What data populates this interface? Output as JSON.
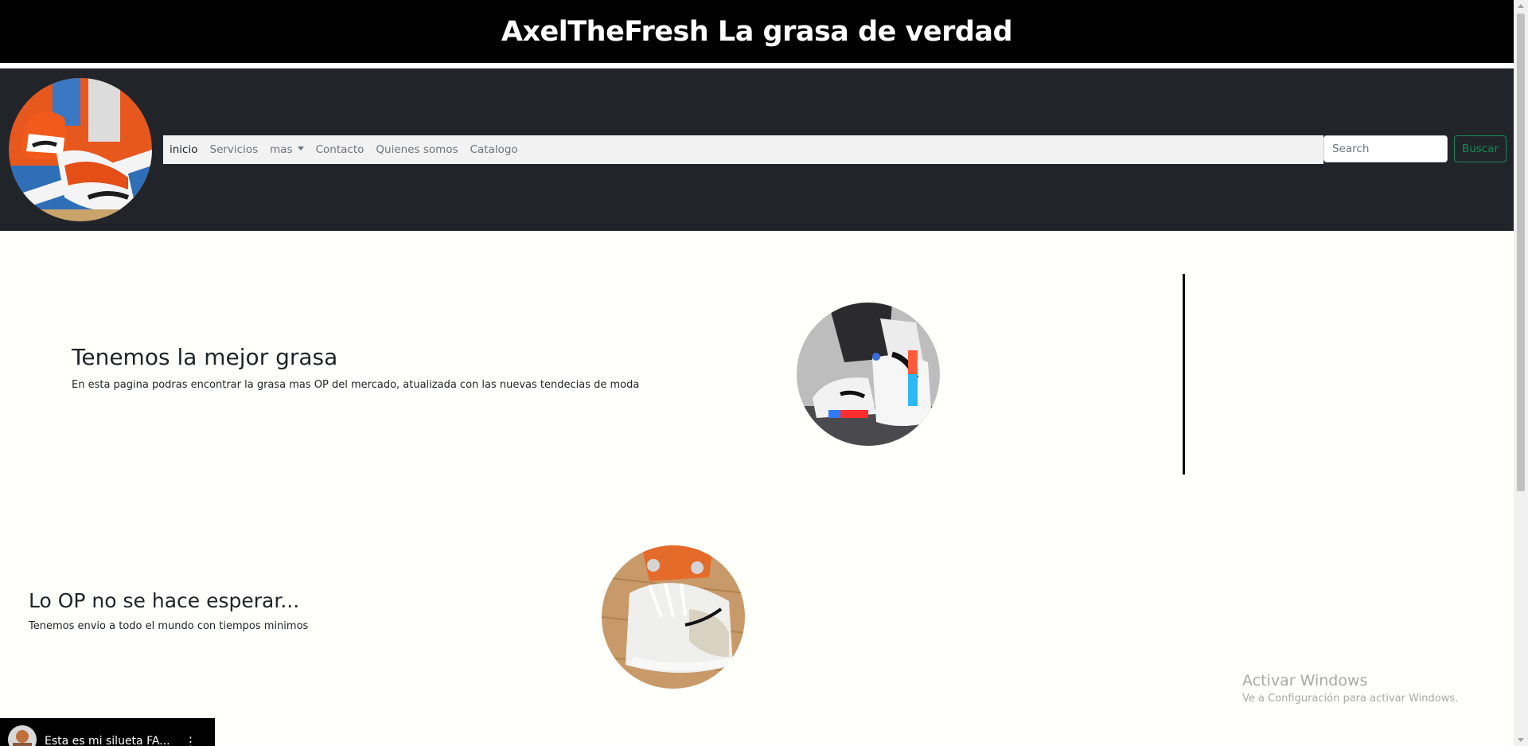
{
  "header": {
    "title": "AxelTheFresh La grasa de verdad"
  },
  "nav": {
    "items": [
      {
        "label": "inicio"
      },
      {
        "label": "Servicios"
      },
      {
        "label": "mas"
      },
      {
        "label": "Contacto"
      },
      {
        "label": "Quienes somos"
      },
      {
        "label": "Catalogo"
      }
    ],
    "search_placeholder": "Search",
    "search_button": "Buscar"
  },
  "sections": [
    {
      "title": "Tenemos la mejor grasa",
      "text": "En esta pagina podras encontrar la grasa mas OP del mercado, atualizada con las nuevas tendecias de moda"
    },
    {
      "title": "Lo OP no se hace esperar...",
      "text": "Tenemos envio a todo el mundo con tiempos minimos"
    }
  ],
  "watermark": {
    "title": "Activar Windows",
    "subtitle": "Ve a Configuración para activar Windows."
  },
  "mini_player": {
    "title": "Esta es mi silueta FA..."
  },
  "colors": {
    "navbar_bg": "#212529",
    "accent_green": "#198754",
    "page_bg": "#fffffb"
  }
}
